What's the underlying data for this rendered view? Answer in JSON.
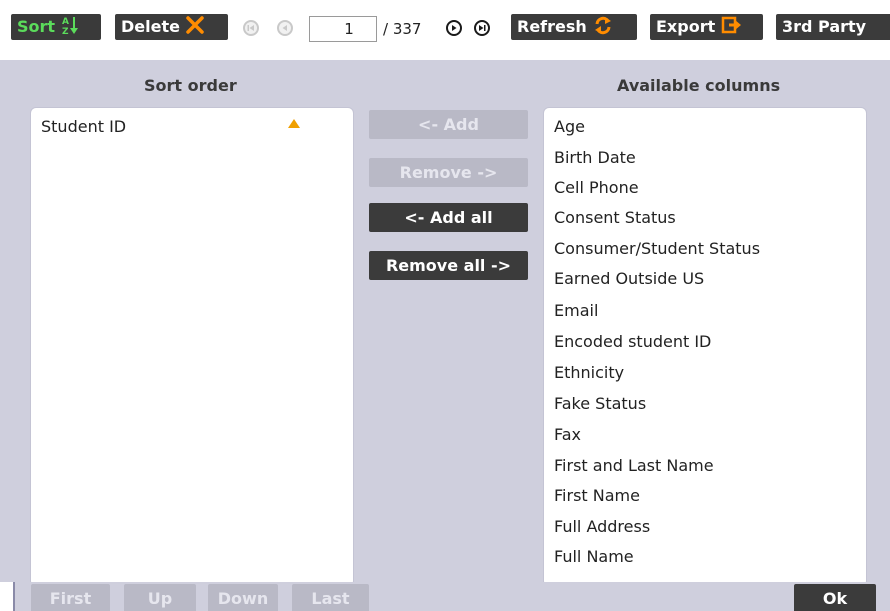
{
  "toolbar": {
    "sort_label": "Sort",
    "delete_label": "Delete",
    "page_value": "1",
    "page_total": "/ 337",
    "refresh_label": "Refresh",
    "export_label": "Export",
    "third_party_label": "3rd Party"
  },
  "panel": {
    "sort_order_heading": "Sort order",
    "available_heading": "Available columns",
    "sort_items": [
      "Student ID"
    ],
    "available_items": [
      "Age",
      "Birth Date",
      "Cell Phone",
      "Consent Status",
      "Consumer/Student Status",
      "Earned Outside US",
      "Email",
      "Encoded student ID",
      "Ethnicity",
      "Fake Status",
      "Fax",
      "First and Last Name",
      "First Name",
      "Full Address",
      "Full Name"
    ],
    "add_label": "<- Add",
    "remove_label": "Remove ->",
    "add_all_label": "<- Add all",
    "remove_all_label": "Remove all ->"
  },
  "footer": {
    "first_label": "First",
    "up_label": "Up",
    "down_label": "Down",
    "last_label": "Last",
    "ok_label": "Ok"
  },
  "colors": {
    "accent_green": "#5bdc5b",
    "delete_orange": "#ff8c00",
    "sort_arrow": "#f0a000",
    "button_dark": "#3b3b3b",
    "button_disabled": "#b9b9c6",
    "panel_bg": "#cfcfdd"
  },
  "icons": {
    "sort": "sort-az-icon",
    "delete": "close-x-icon",
    "first_page": "first-page-icon",
    "prev_page": "prev-page-icon",
    "next_page": "next-page-icon",
    "last_page": "last-page-icon",
    "refresh": "refresh-icon",
    "export": "export-icon",
    "sort_direction": "ascending-arrow-icon"
  }
}
